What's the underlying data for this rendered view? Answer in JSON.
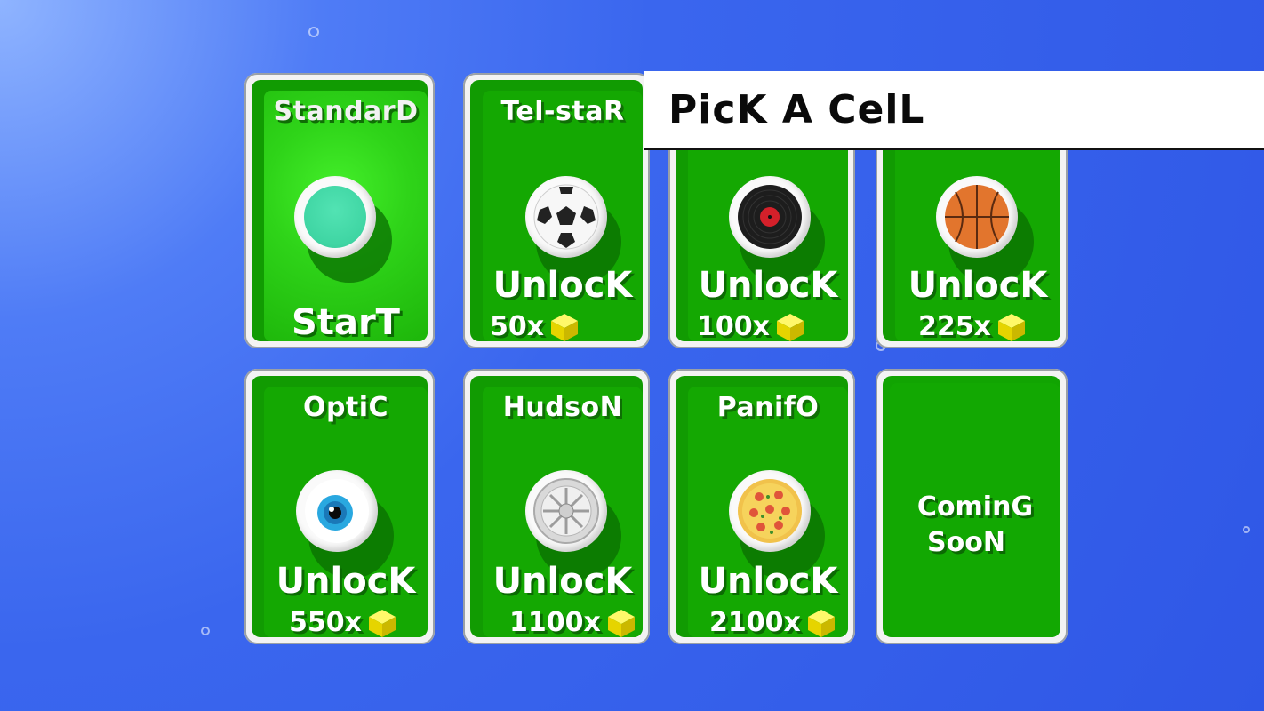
{
  "header": {
    "title": "PicK A CelL"
  },
  "cells": [
    {
      "name": "StandarD",
      "action": "StarT",
      "icon": "teal-hole-icon",
      "selected": true
    },
    {
      "name": "Tel-staR",
      "action": "UnlocK",
      "price": "50x",
      "icon": "soccer-ball-icon"
    },
    {
      "name": "",
      "action": "UnlocK",
      "price": "100x",
      "icon": "vinyl-record-icon"
    },
    {
      "name": "",
      "action": "UnlocK",
      "price": "225x",
      "icon": "basketball-icon"
    },
    {
      "name": "OptiC",
      "action": "UnlocK",
      "price": "550x",
      "icon": "eyeball-icon"
    },
    {
      "name": "HudsoN",
      "action": "UnlocK",
      "price": "1100x",
      "icon": "wheel-rim-icon"
    },
    {
      "name": "PanifO",
      "action": "UnlocK",
      "price": "2100x",
      "icon": "pizza-icon"
    },
    {
      "name": "ComingSoon",
      "line1": "CominG",
      "line2": "SooN"
    }
  ],
  "colors": {
    "background": "#3a66ee",
    "card_green": "#14a802",
    "coin_yellow": "#f3e400"
  }
}
